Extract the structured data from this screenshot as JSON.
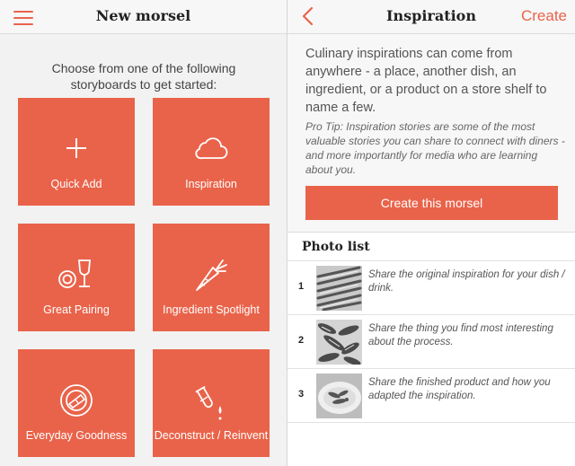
{
  "left": {
    "title": "New morsel",
    "intro": "Choose from one of the following storyboards to get started:",
    "tiles": [
      {
        "label": "Quick Add",
        "icon": "plus-icon"
      },
      {
        "label": "Inspiration",
        "icon": "cloud-icon"
      },
      {
        "label": "Great Pairing",
        "icon": "plate-wine-glass-icon"
      },
      {
        "label": "Ingredient Spotlight",
        "icon": "carrot-icon"
      },
      {
        "label": "Everyday Goodness",
        "icon": "plate-food-icon"
      },
      {
        "label": "Deconstruct / Reinvent",
        "icon": "test-tube-icon"
      }
    ]
  },
  "right": {
    "title": "Inspiration",
    "create_label": "Create",
    "description": "Culinary inspirations can come from anywhere - a place, another dish, an ingredient, or a product on a store shelf to name a few.",
    "pro_tip": "Pro Tip: Inspiration stories are some of the most valuable stories you can share to connect with diners - and more importantly for media who are learning about you.",
    "cta_label": "Create this morsel",
    "photo_list": {
      "heading": "Photo list",
      "items": [
        {
          "number": "1",
          "text": "Share the original inspiration for your dish / drink."
        },
        {
          "number": "2",
          "text": "Share the thing you find most interesting about the process."
        },
        {
          "number": "3",
          "text": "Share the finished product and how you adapted the inspiration."
        }
      ]
    }
  },
  "colors": {
    "accent": "#e9634a",
    "background": "#f2f2f2",
    "navbar": "#f7f7f7"
  }
}
